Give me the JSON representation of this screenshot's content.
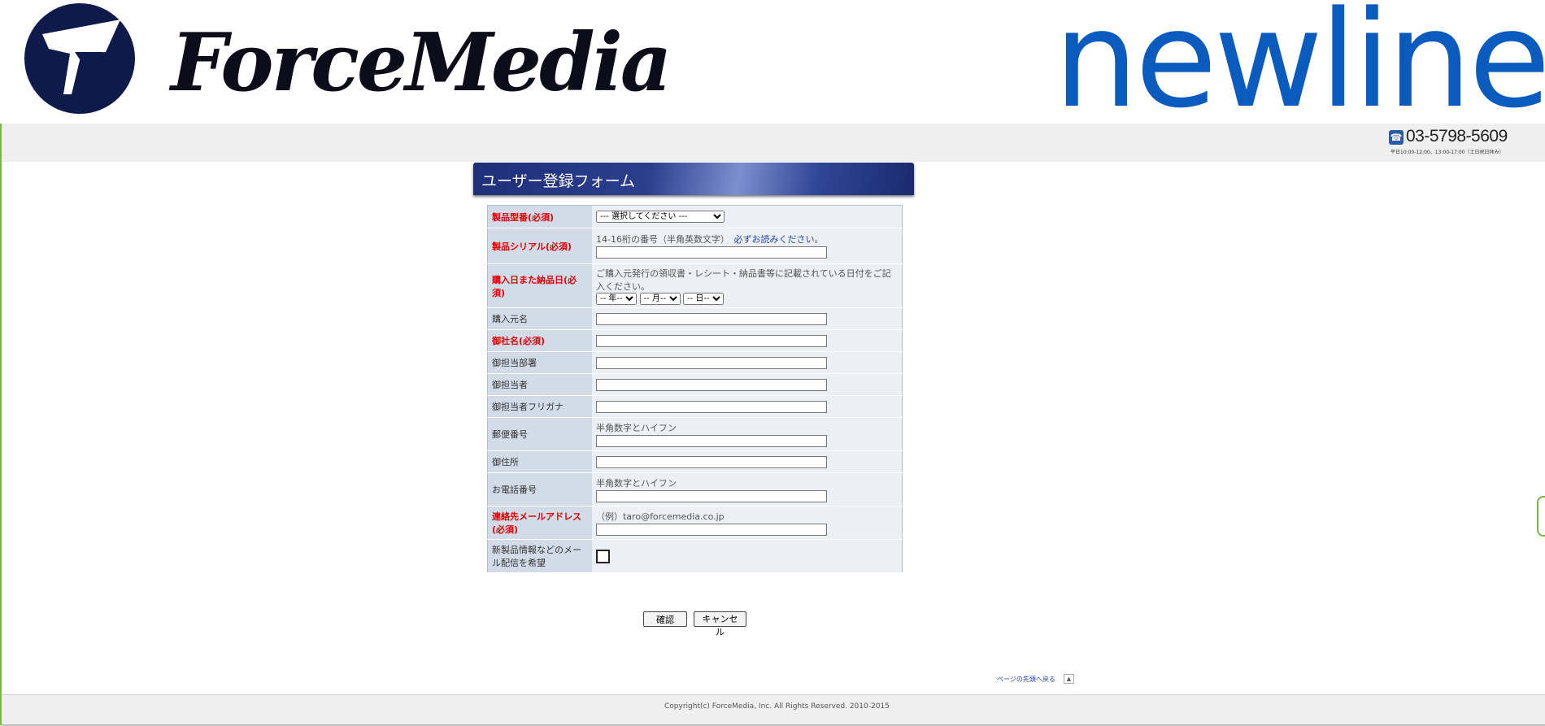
{
  "header": {
    "brand_name": "ForceMedia",
    "partner_brand": "newline",
    "phone_number": "03-5798-5609",
    "phone_hours": "平日10:00-12:00、13:00-17:00（土日祝日休み）"
  },
  "form": {
    "title": "ユーザー登録フォーム",
    "rows": {
      "model": {
        "label": "製品型番(必須)",
        "select_value": "--- 選択してください ---"
      },
      "serial": {
        "label": "製品シリアル(必須)",
        "note": "14-16桁の番号（半角英数文字）",
        "link": "必ずお読みください",
        "link_suffix": "。"
      },
      "purchase_date": {
        "label": "購入日また納品日(必須)",
        "note": "ご購入元発行の領収書・レシート・納品書等に記載されている日付をご記入ください。",
        "year": "-- 年--",
        "month": "-- 月--",
        "day": "-- 日--"
      },
      "vendor": {
        "label": "購入元名"
      },
      "company": {
        "label": "御社名(必須)"
      },
      "department": {
        "label": "御担当部署"
      },
      "person": {
        "label": "御担当者"
      },
      "person_kana": {
        "label": "御担当者フリガナ"
      },
      "postal": {
        "label": "郵便番号",
        "note": "半角数字とハイフン"
      },
      "address": {
        "label": "御住所"
      },
      "phone": {
        "label": "お電話番号",
        "note": "半角数字とハイフン"
      },
      "email": {
        "label": "連絡先メールアドレス(必須)",
        "note": "（例）taro@forcemedia.co.jp"
      },
      "newsletter": {
        "label": "新製品情報などのメール配信を希望"
      }
    },
    "confirm_label": "確認",
    "cancel_label": "キャンセル"
  },
  "back_to_top": "ページの先頭へ戻る",
  "footer": {
    "copyright": "Copyright(c) ForceMedia, Inc. All Rights Reserved. 2010-2015"
  },
  "colors": {
    "accent": "#0a5bbd",
    "required": "#e10000",
    "title_bar": "#2b3f8f"
  }
}
